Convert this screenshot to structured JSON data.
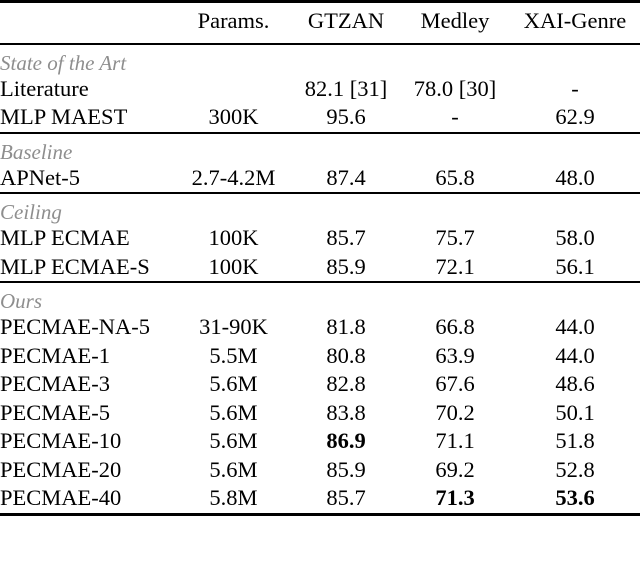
{
  "table": {
    "columns": [
      {
        "key": "model",
        "label": "",
        "align": "left"
      },
      {
        "key": "params",
        "label": "Params.",
        "align": "center"
      },
      {
        "key": "gtzan",
        "label": "GTZAN",
        "align": "center"
      },
      {
        "key": "medley",
        "label": "Medley",
        "align": "center"
      },
      {
        "key": "xai",
        "label": "XAI-Genre",
        "align": "center"
      }
    ],
    "sections": [
      {
        "label": "State of the Art",
        "rows": [
          {
            "model": "Literature",
            "params": "",
            "gtzan": "82.1 [31]",
            "medley": "78.0 [30]",
            "xai": "-",
            "bold": []
          },
          {
            "model": "MLP MAEST",
            "params": "300K",
            "gtzan": "95.6",
            "medley": "-",
            "xai": "62.9",
            "bold": []
          }
        ]
      },
      {
        "label": "Baseline",
        "rows": [
          {
            "model": "APNet-5",
            "params": "2.7-4.2M",
            "gtzan": "87.4",
            "medley": "65.8",
            "xai": "48.0",
            "bold": []
          }
        ]
      },
      {
        "label": "Ceiling",
        "rows": [
          {
            "model": "MLP ECMAE",
            "params": "100K",
            "gtzan": "85.7",
            "medley": "75.7",
            "xai": "58.0",
            "bold": []
          },
          {
            "model": "MLP ECMAE-S",
            "params": "100K",
            "gtzan": "85.9",
            "medley": "72.1",
            "xai": "56.1",
            "bold": []
          }
        ]
      },
      {
        "label": "Ours",
        "rows": [
          {
            "model": "PECMAE-NA-5",
            "params": "31-90K",
            "gtzan": "81.8",
            "medley": "66.8",
            "xai": "44.0",
            "bold": []
          },
          {
            "model": "PECMAE-1",
            "params": "5.5M",
            "gtzan": "80.8",
            "medley": "63.9",
            "xai": "44.0",
            "bold": []
          },
          {
            "model": "PECMAE-3",
            "params": "5.6M",
            "gtzan": "82.8",
            "medley": "67.6",
            "xai": "48.6",
            "bold": []
          },
          {
            "model": "PECMAE-5",
            "params": "5.6M",
            "gtzan": "83.8",
            "medley": "70.2",
            "xai": "50.1",
            "bold": []
          },
          {
            "model": "PECMAE-10",
            "params": "5.6M",
            "gtzan": "86.9",
            "medley": "71.1",
            "xai": "51.8",
            "bold": [
              "gtzan"
            ]
          },
          {
            "model": "PECMAE-20",
            "params": "5.6M",
            "gtzan": "85.9",
            "medley": "69.2",
            "xai": "52.8",
            "bold": []
          },
          {
            "model": "PECMAE-40",
            "params": "5.8M",
            "gtzan": "85.7",
            "medley": "71.3",
            "xai": "53.6",
            "bold": [
              "medley",
              "xai"
            ]
          }
        ]
      }
    ],
    "colors": {
      "text": "#000000",
      "section_label": "#8e8e8e",
      "rule": "#000000",
      "background": "#ffffff"
    }
  }
}
